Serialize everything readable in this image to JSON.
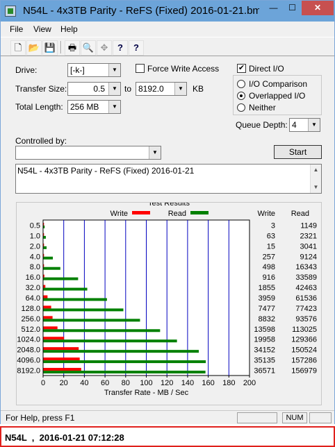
{
  "window": {
    "title": "N54L - 4x3TB Parity - ReFS (Fixed) 2016-01-21.bm...",
    "min": "—",
    "max": "☐",
    "close": "✕"
  },
  "menu": {
    "file": "File",
    "view": "View",
    "help": "Help"
  },
  "toolbar": {
    "icons": [
      "new-icon",
      "open-icon",
      "save-icon",
      "print-icon",
      "print-preview-icon",
      "move-icon",
      "help-icon",
      "context-help-icon"
    ],
    "glyphs": [
      "🗋",
      "📂",
      "💾",
      "🖶",
      "🔍",
      "✥",
      "?",
      "?"
    ]
  },
  "settings": {
    "drive_label": "Drive:",
    "drive_value": "[-k-]",
    "force_write_label": "Force Write Access",
    "force_write_checked": false,
    "transfer_size_label": "Transfer Size:",
    "transfer_from": "0.5",
    "to_label": "to",
    "transfer_to": "8192.0",
    "kb_label": "KB",
    "total_length_label": "Total Length:",
    "total_length_value": "256 MB",
    "direct_io_label": "Direct I/O",
    "direct_io_checked": true,
    "io_options": [
      "I/O Comparison",
      "Overlapped I/O",
      "Neither"
    ],
    "io_selected": "Overlapped I/O",
    "queue_depth_label": "Queue Depth:",
    "queue_depth_value": "4",
    "controlled_by_label": "Controlled by:",
    "controlled_by_value": "",
    "start_label": "Start",
    "description": "N54L - 4x3TB Parity - ReFS (Fixed) 2016-01-21"
  },
  "results": {
    "group_title": "Test Results",
    "write_legend": "Write",
    "read_legend": "Read",
    "write_header": "Write",
    "read_header": "Read"
  },
  "chart_data": {
    "type": "bar",
    "orientation": "horizontal",
    "title": "Test Results",
    "xlabel": "Transfer Rate - MB / Sec",
    "xlim": [
      0,
      200
    ],
    "xticks": [
      "0",
      "20",
      "40",
      "60",
      "80",
      "100",
      "120",
      "140",
      "160",
      "180",
      "200"
    ],
    "categories": [
      "0.5",
      "1.0",
      "2.0",
      "4.0",
      "8.0",
      "16.0",
      "32.0",
      "64.0",
      "128.0",
      "256.0",
      "512.0",
      "1024.0",
      "2048.0",
      "4096.0",
      "8192.0"
    ],
    "series": [
      {
        "name": "Write",
        "color": "#ff0000",
        "values": [
          0.003,
          0.063,
          0.015,
          0.257,
          0.498,
          0.916,
          1.855,
          3.959,
          7.477,
          8.832,
          13.598,
          19.958,
          34.152,
          35.135,
          36.571
        ]
      },
      {
        "name": "Read",
        "color": "#008000",
        "values": [
          1.149,
          2.321,
          3.041,
          9.124,
          16.343,
          33.589,
          42.463,
          61.536,
          77.423,
          93.576,
          113.025,
          129.366,
          150.524,
          157.286,
          156.979
        ]
      }
    ],
    "write_column": [
      "3",
      "63",
      "15",
      "257",
      "498",
      "916",
      "1855",
      "3959",
      "7477",
      "8832",
      "13598",
      "19958",
      "34152",
      "35135",
      "36571"
    ],
    "read_column": [
      "1149",
      "2321",
      "3041",
      "9124",
      "16343",
      "33589",
      "42463",
      "61536",
      "77423",
      "93576",
      "113025",
      "129366",
      "150524",
      "157286",
      "156979"
    ],
    "grid_color": "#0000c0"
  },
  "status": {
    "help_text": "For Help, press F1",
    "pane_num": "NUM"
  },
  "caption": {
    "text": "N54L  ,  2016-01-21 07:12:28"
  }
}
